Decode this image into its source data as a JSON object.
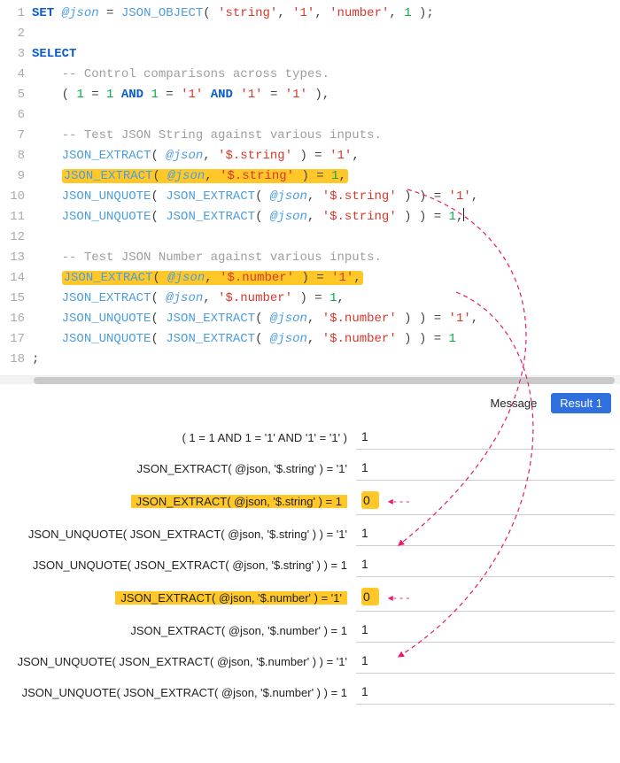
{
  "editor": {
    "lines": [
      {
        "n": 1,
        "tokens": [
          [
            "kw",
            "SET"
          ],
          [
            "op",
            " "
          ],
          [
            "var",
            "@json"
          ],
          [
            "op",
            " = "
          ],
          [
            "fn",
            "JSON_OBJECT"
          ],
          [
            "op",
            "( "
          ],
          [
            "str",
            "'string'"
          ],
          [
            "op",
            ", "
          ],
          [
            "str",
            "'1'"
          ],
          [
            "op",
            ", "
          ],
          [
            "str",
            "'number'"
          ],
          [
            "op",
            ", "
          ],
          [
            "num",
            "1"
          ],
          [
            "op",
            " );"
          ]
        ]
      },
      {
        "n": 2,
        "tokens": []
      },
      {
        "n": 3,
        "tokens": [
          [
            "kw",
            "SELECT"
          ]
        ]
      },
      {
        "n": 4,
        "tokens": [
          [
            "op",
            "    "
          ],
          [
            "cmt",
            "-- Control comparisons across types."
          ]
        ]
      },
      {
        "n": 5,
        "tokens": [
          [
            "op",
            "    ( "
          ],
          [
            "num",
            "1"
          ],
          [
            "op",
            " = "
          ],
          [
            "num",
            "1"
          ],
          [
            "op",
            " "
          ],
          [
            "kw",
            "AND"
          ],
          [
            "op",
            " "
          ],
          [
            "num",
            "1"
          ],
          [
            "op",
            " = "
          ],
          [
            "str",
            "'1'"
          ],
          [
            "op",
            " "
          ],
          [
            "kw",
            "AND"
          ],
          [
            "op",
            " "
          ],
          [
            "str",
            "'1'"
          ],
          [
            "op",
            " = "
          ],
          [
            "str",
            "'1'"
          ],
          [
            "op",
            " ),"
          ]
        ]
      },
      {
        "n": 6,
        "tokens": []
      },
      {
        "n": 7,
        "tokens": [
          [
            "op",
            "    "
          ],
          [
            "cmt",
            "-- Test JSON String against various inputs."
          ]
        ]
      },
      {
        "n": 8,
        "tokens": [
          [
            "op",
            "    "
          ],
          [
            "fn",
            "JSON_EXTRACT"
          ],
          [
            "op",
            "( "
          ],
          [
            "var",
            "@json"
          ],
          [
            "op",
            ", "
          ],
          [
            "str",
            "'$.string'"
          ],
          [
            "op",
            " ) = "
          ],
          [
            "str",
            "'1'"
          ],
          [
            "op",
            ","
          ]
        ]
      },
      {
        "n": 9,
        "hl": true,
        "tokens": [
          [
            "op",
            "    "
          ],
          [
            "fn",
            "JSON_EXTRACT"
          ],
          [
            "op",
            "( "
          ],
          [
            "var",
            "@json"
          ],
          [
            "op",
            ", "
          ],
          [
            "str",
            "'$.string'"
          ],
          [
            "op",
            " ) = "
          ],
          [
            "num",
            "1"
          ],
          [
            "op",
            ","
          ]
        ]
      },
      {
        "n": 10,
        "tokens": [
          [
            "op",
            "    "
          ],
          [
            "fn",
            "JSON_UNQUOTE"
          ],
          [
            "op",
            "( "
          ],
          [
            "fn",
            "JSON_EXTRACT"
          ],
          [
            "op",
            "( "
          ],
          [
            "var",
            "@json"
          ],
          [
            "op",
            ", "
          ],
          [
            "str",
            "'$.string'"
          ],
          [
            "op",
            " ) ) = "
          ],
          [
            "str",
            "'1'"
          ],
          [
            "op",
            ","
          ]
        ]
      },
      {
        "n": 11,
        "tokens": [
          [
            "op",
            "    "
          ],
          [
            "fn",
            "JSON_UNQUOTE"
          ],
          [
            "op",
            "( "
          ],
          [
            "fn",
            "JSON_EXTRACT"
          ],
          [
            "op",
            "( "
          ],
          [
            "var",
            "@json"
          ],
          [
            "op",
            ", "
          ],
          [
            "str",
            "'$.string'"
          ],
          [
            "op",
            " ) ) = "
          ],
          [
            "num",
            "1"
          ],
          [
            "op",
            ","
          ]
        ],
        "caret": true
      },
      {
        "n": 12,
        "tokens": []
      },
      {
        "n": 13,
        "tokens": [
          [
            "op",
            "    "
          ],
          [
            "cmt",
            "-- Test JSON Number against various inputs."
          ]
        ]
      },
      {
        "n": 14,
        "hl": true,
        "tokens": [
          [
            "op",
            "    "
          ],
          [
            "fn",
            "JSON_EXTRACT"
          ],
          [
            "op",
            "( "
          ],
          [
            "var",
            "@json"
          ],
          [
            "op",
            ", "
          ],
          [
            "str",
            "'$.number'"
          ],
          [
            "op",
            " ) = "
          ],
          [
            "str",
            "'1'"
          ],
          [
            "op",
            ","
          ]
        ]
      },
      {
        "n": 15,
        "tokens": [
          [
            "op",
            "    "
          ],
          [
            "fn",
            "JSON_EXTRACT"
          ],
          [
            "op",
            "( "
          ],
          [
            "var",
            "@json"
          ],
          [
            "op",
            ", "
          ],
          [
            "str",
            "'$.number'"
          ],
          [
            "op",
            " ) = "
          ],
          [
            "num",
            "1"
          ],
          [
            "op",
            ","
          ]
        ]
      },
      {
        "n": 16,
        "tokens": [
          [
            "op",
            "    "
          ],
          [
            "fn",
            "JSON_UNQUOTE"
          ],
          [
            "op",
            "( "
          ],
          [
            "fn",
            "JSON_EXTRACT"
          ],
          [
            "op",
            "( "
          ],
          [
            "var",
            "@json"
          ],
          [
            "op",
            ", "
          ],
          [
            "str",
            "'$.number'"
          ],
          [
            "op",
            " ) ) = "
          ],
          [
            "str",
            "'1'"
          ],
          [
            "op",
            ","
          ]
        ]
      },
      {
        "n": 17,
        "tokens": [
          [
            "op",
            "    "
          ],
          [
            "fn",
            "JSON_UNQUOTE"
          ],
          [
            "op",
            "( "
          ],
          [
            "fn",
            "JSON_EXTRACT"
          ],
          [
            "op",
            "( "
          ],
          [
            "var",
            "@json"
          ],
          [
            "op",
            ", "
          ],
          [
            "str",
            "'$.number'"
          ],
          [
            "op",
            " ) ) = "
          ],
          [
            "num",
            "1"
          ]
        ]
      },
      {
        "n": 18,
        "tokens": [
          [
            "op",
            ";"
          ]
        ]
      }
    ]
  },
  "tabs": {
    "message": "Message",
    "result1": "Result 1"
  },
  "results": {
    "rows": [
      {
        "label": "( 1 = 1 AND 1 = '1' AND '1' = '1' )",
        "value": "1",
        "hl": false
      },
      {
        "label": "JSON_EXTRACT( @json, '$.string' ) = '1'",
        "value": "1",
        "hl": false
      },
      {
        "label": "JSON_EXTRACT( @json, '$.string' ) = 1",
        "value": "0",
        "hl": true
      },
      {
        "label": "JSON_UNQUOTE( JSON_EXTRACT( @json, '$.string' ) ) = '1'",
        "value": "1",
        "hl": false
      },
      {
        "label": "JSON_UNQUOTE( JSON_EXTRACT( @json, '$.string' ) ) = 1",
        "value": "1",
        "hl": false
      },
      {
        "label": "JSON_EXTRACT( @json, '$.number' ) = '1'",
        "value": "0",
        "hl": true
      },
      {
        "label": "JSON_EXTRACT( @json, '$.number' ) = 1",
        "value": "1",
        "hl": false
      },
      {
        "label": "JSON_UNQUOTE( JSON_EXTRACT( @json, '$.number' ) ) = '1'",
        "value": "1",
        "hl": false
      },
      {
        "label": "JSON_UNQUOTE( JSON_EXTRACT( @json, '$.number' ) ) = 1",
        "value": "1",
        "hl": false
      }
    ]
  }
}
